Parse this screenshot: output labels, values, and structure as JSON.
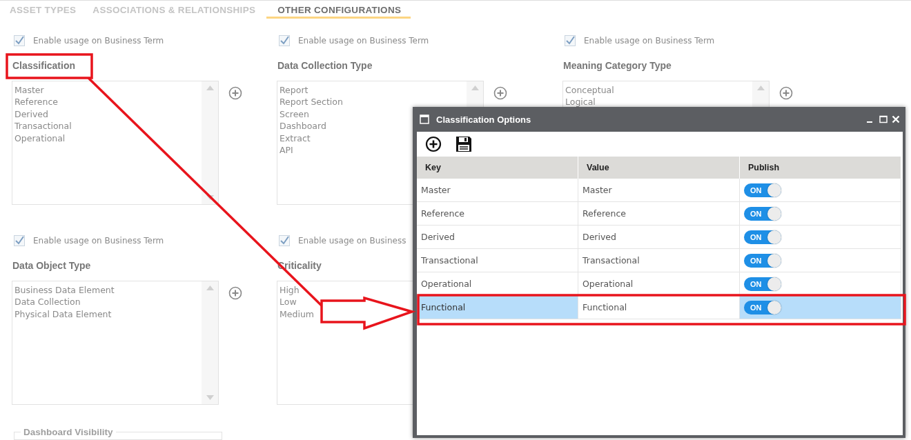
{
  "tabs": [
    {
      "label": "ASSET TYPES",
      "selected": false
    },
    {
      "label": "ASSOCIATIONS & RELATIONSHIPS",
      "selected": false
    },
    {
      "label": "OTHER CONFIGURATIONS",
      "selected": true
    }
  ],
  "panels": [
    {
      "checkbox": {
        "label": "Enable usage on Business Term",
        "checked": true
      },
      "title": "Classification",
      "items": [
        "Master",
        "Reference",
        "Derived",
        "Transactional",
        "Operational"
      ]
    },
    {
      "checkbox": {
        "label": "Enable usage on Business Term",
        "checked": true
      },
      "title": "Data Collection Type",
      "items": [
        "Report",
        "Report Section",
        "Screen",
        "Dashboard",
        "Extract",
        "API"
      ]
    },
    {
      "checkbox": {
        "label": "Enable usage on Business Term",
        "checked": true
      },
      "title": "Meaning Category Type",
      "items": [
        "Conceptual",
        "Logical"
      ]
    },
    {
      "checkbox": {
        "label": "Enable usage on Business Term",
        "checked": true
      },
      "title": "Data Object Type",
      "items": [
        "Business Data Element",
        "Data Collection",
        "Physical Data Element"
      ]
    },
    {
      "checkbox": {
        "label": "Enable usage on Business",
        "checked": true
      },
      "title": "Criticality",
      "items": [
        "High",
        "Low",
        "Medium"
      ]
    }
  ],
  "dashboard_visibility": {
    "title": "Dashboard Visibility"
  },
  "dialog": {
    "title": "Classification Options",
    "columns": [
      "Key",
      "Value",
      "Publish"
    ],
    "rows": [
      {
        "key": "Master",
        "value": "Master",
        "publish": "ON",
        "on": true,
        "selected": false
      },
      {
        "key": "Reference",
        "value": "Reference",
        "publish": "ON",
        "on": true,
        "selected": false
      },
      {
        "key": "Derived",
        "value": "Derived",
        "publish": "ON",
        "on": true,
        "selected": false
      },
      {
        "key": "Transactional",
        "value": "Transactional",
        "publish": "ON",
        "on": true,
        "selected": false
      },
      {
        "key": "Operational",
        "value": "Operational",
        "publish": "ON",
        "on": true,
        "selected": false
      },
      {
        "key": "Functional",
        "value": "Functional",
        "publish": "ON",
        "on": true,
        "selected": true
      }
    ]
  }
}
